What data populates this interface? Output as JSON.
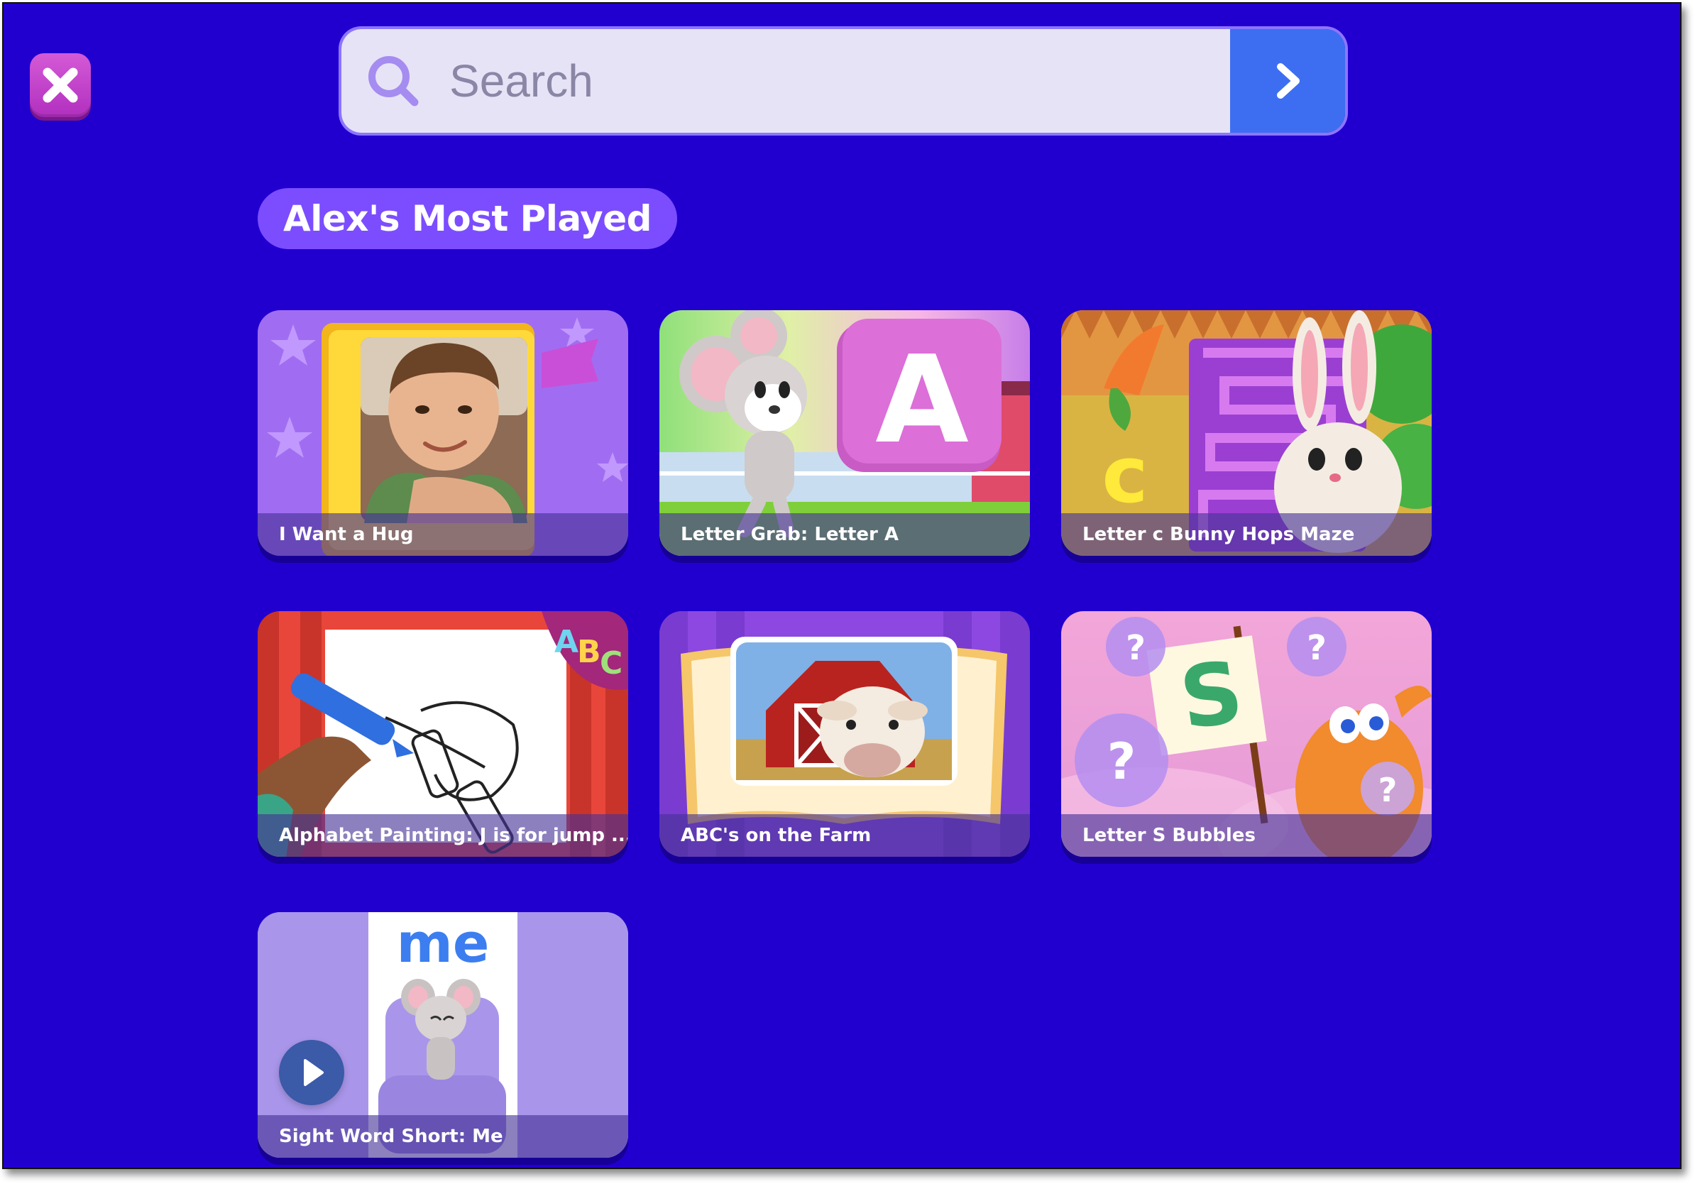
{
  "search": {
    "placeholder": "Search"
  },
  "section": {
    "title": "Alex's Most Played"
  },
  "activities": [
    {
      "title": "I Want a Hug"
    },
    {
      "title": "Letter Grab: Letter A",
      "art_letter": "A"
    },
    {
      "title": "Letter c Bunny Hops Maze",
      "art_letter": "c"
    },
    {
      "title": "Alphabet Painting:  J is for jump ...",
      "art_letters": [
        "A",
        "B",
        "C"
      ]
    },
    {
      "title": "ABC's on the Farm"
    },
    {
      "title": "Letter S Bubbles",
      "art_letter": "S"
    },
    {
      "title": "Sight Word Short: Me",
      "art_word": "me"
    }
  ],
  "colors": {
    "background": "#2100cf",
    "close_button": "#c142c9",
    "search_go": "#3d6ef2",
    "section_pill": "#7c4dff"
  },
  "icons": {
    "close": "close-icon",
    "search": "search-icon",
    "go": "chevron-right-icon",
    "play": "play-icon"
  }
}
